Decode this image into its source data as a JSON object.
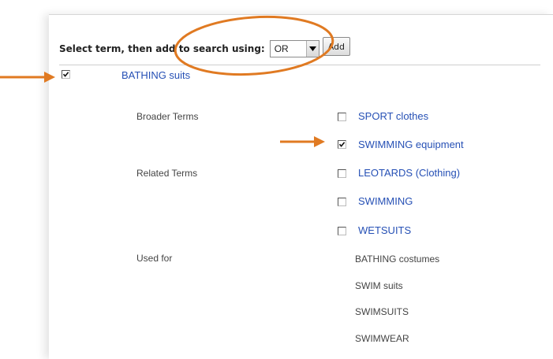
{
  "toolbar": {
    "label": "Select term, then add to search using:",
    "operator_value": "OR",
    "add_label": "Add"
  },
  "term": {
    "label": "BATHING suits",
    "checked": true
  },
  "sections": {
    "broader": "Broader Terms",
    "related": "Related Terms",
    "used_for": "Used for"
  },
  "broader_terms": [
    {
      "label": "SPORT clothes",
      "checked": false
    },
    {
      "label": "SWIMMING equipment",
      "checked": true
    }
  ],
  "related_terms": [
    {
      "label": "LEOTARDS (Clothing)",
      "checked": false
    },
    {
      "label": "SWIMMING",
      "checked": false
    },
    {
      "label": "WETSUITS",
      "checked": false
    }
  ],
  "used_for": [
    "BATHING costumes",
    "SWIM suits",
    "SWIMSUITS",
    "SWIMWEAR"
  ],
  "colors": {
    "link": "#2650b5",
    "annotation": "#e07a22"
  },
  "icons": {
    "checkbox": "checkbox-icon",
    "checkmark": "checkmark-icon",
    "dropdown": "chevron-down-icon",
    "arrow": "arrow-right-icon"
  }
}
